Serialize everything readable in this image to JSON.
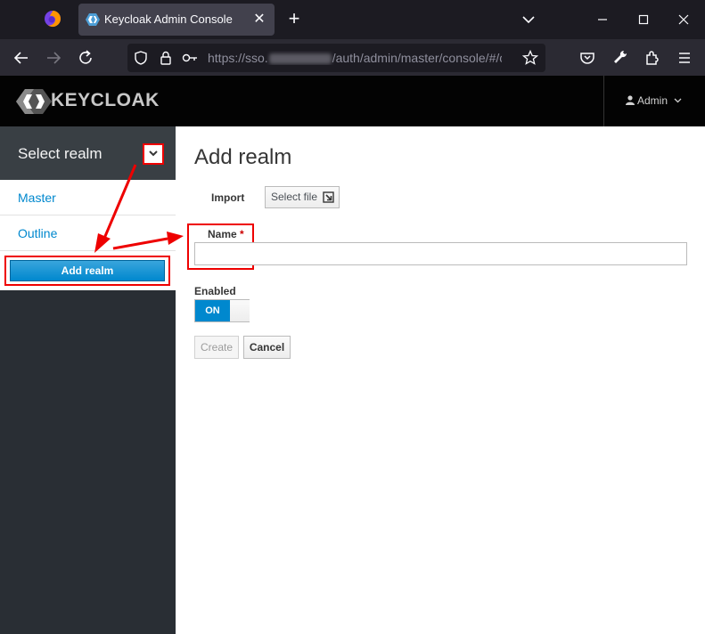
{
  "browser": {
    "tab_title": "Keycloak Admin Console",
    "url_prefix": "https://sso.",
    "url_suffix": "/auth/admin/master/console/#/cre"
  },
  "header": {
    "logo_text": "KEYCLOAK",
    "user_label": "Admin"
  },
  "sidebar": {
    "realm_selector_label": "Select realm",
    "realms": [
      "Master",
      "Outline"
    ],
    "add_realm_label": "Add realm"
  },
  "main": {
    "title": "Add realm",
    "import_label": "Import",
    "select_file_label": "Select file",
    "name_label": "Name",
    "required_marker": "*",
    "name_value": "",
    "enabled_label": "Enabled",
    "enabled_state": "ON",
    "create_label": "Create",
    "cancel_label": "Cancel"
  },
  "colors": {
    "accent": "#0088ce",
    "annotation": "#e00000",
    "sidebar_bg": "#292e34"
  }
}
